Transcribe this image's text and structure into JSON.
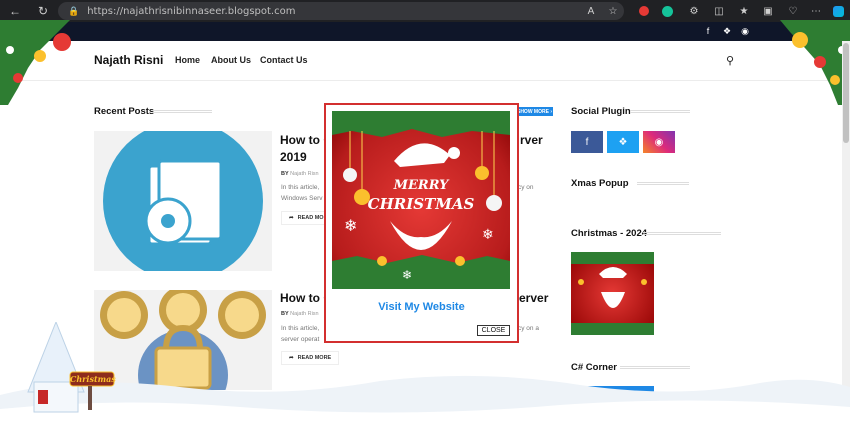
{
  "browser": {
    "url": "https://najathrisnibinnaseer.blogspot.com"
  },
  "site": {
    "brand": "Najath Risni",
    "menu": [
      "Home",
      "About Us",
      "Contact Us"
    ]
  },
  "recent": {
    "heading": "Recent Posts",
    "show_more": "SHOW MORE",
    "posts": [
      {
        "title_line1": "How to C",
        "title_line1_end": "rver",
        "title_line2": "2019",
        "by": "BY",
        "author": "Najath Risn",
        "excerpt1": "In this article,",
        "excerpt1_end": "cy on",
        "excerpt2": "Windows Serv",
        "read_more": "READ MOR"
      },
      {
        "title_line1": "How to C",
        "title_line1_end": "erver",
        "by": "BY",
        "author": "Najath Risn",
        "excerpt1": "In this article,",
        "excerpt1_end": "cy on a",
        "excerpt2": "server operat",
        "read_more": "READ MORE"
      }
    ]
  },
  "sidebar": {
    "social_heading": "Social Plugin",
    "xmas_popup_heading": "Xmas Popup",
    "christmas_heading": "Christmas - 2024",
    "csharp_heading": "C# Corner"
  },
  "popup": {
    "merry": "MERRY",
    "christmas": "CHRISTMAS",
    "visit": "Visit My Website",
    "close": "CLOSE"
  },
  "decor": {
    "sign": "Christmas"
  }
}
